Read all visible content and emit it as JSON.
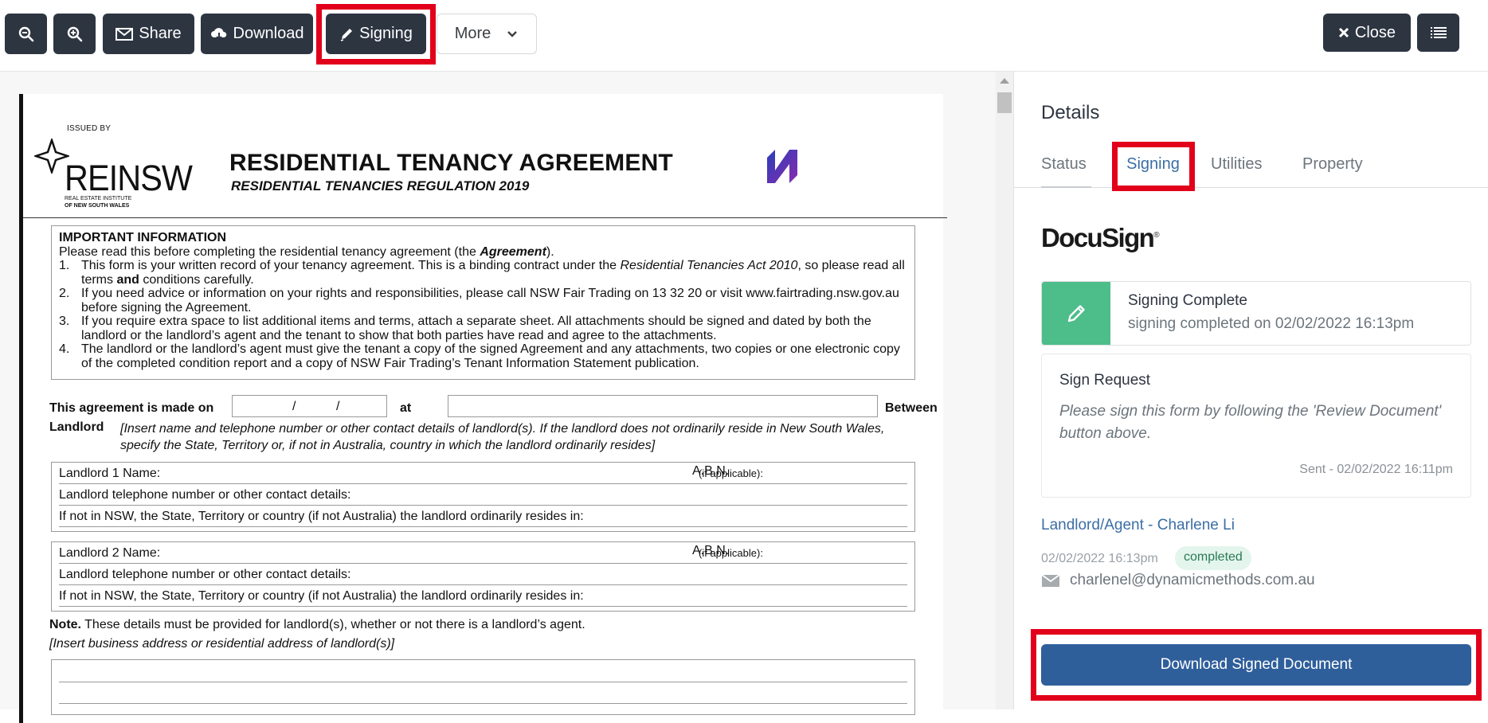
{
  "toolbar": {
    "zoom_out_icon": "zoom-out-icon",
    "zoom_in_icon": "zoom-in-icon",
    "share_label": "Share",
    "download_label": "Download",
    "signing_label": "Signing",
    "more_label": "More",
    "close_label": "Close"
  },
  "document": {
    "issued_by": "ISSUED BY",
    "logo_text": "REINSW",
    "logo_sub1": "REAL ESTATE INSTITUTE",
    "logo_sub2": "OF NEW SOUTH WALES",
    "title": "RESIDENTIAL TENANCY AGREEMENT",
    "subtitle": "RESIDENTIAL TENANCIES REGULATION 2019",
    "important_heading": "IMPORTANT INFORMATION",
    "important_intro_a": "Please read this before completing the residential tenancy agreement (the ",
    "important_intro_b": "Agreement",
    "important_intro_c": ").",
    "items": [
      {
        "n": "1.",
        "a": "This form is your written record of your tenancy agreement. This is a binding contract under the ",
        "i": "Residential Tenancies Act 2010",
        "b": ", so please read all terms ",
        "bold": "and",
        "c": " conditions carefully."
      },
      {
        "n": "2.",
        "a": "If you need advice or information on your rights and responsibilities, please call NSW Fair Trading on 13 32 20 or visit www.fairtrading.nsw.gov.au before signing the Agreement."
      },
      {
        "n": "3.",
        "a": "If you require extra space to list additional items and terms, attach a separate sheet. All attachments should be signed and dated by both the landlord or the landlord’s agent and the tenant to show that both parties have read and agree to the attachments."
      },
      {
        "n": "4.",
        "a": "The landlord or the landlord’s agent must give the tenant a copy of the signed Agreement and any attachments, two copies or one electronic copy of the completed condition report and a copy of NSW Fair Trading’s Tenant Information Statement publication."
      }
    ],
    "made_label": "This agreement is made on",
    "date_sep": "/",
    "at_label": "at",
    "between_label": "Between",
    "landlord_label": "Landlord",
    "landlord_instr": "[Insert name and telephone number or other contact details of landlord(s). If the landlord does not ordinarily reside in New South Wales, specify the State, Territory or, if not in Australia, country in which the landlord ordinarily resides]",
    "landlord1_name": "Landlord 1   Name:",
    "landlord2_name": "Landlord 2   Name:",
    "abn": "A.B.N.",
    "abn_note": "(if applicable):",
    "phone_row": "Landlord telephone number or other contact details:",
    "resides_row": "If not in NSW, the State, Territory or country (if not Australia) the landlord ordinarily resides in:",
    "note_bold": "Note.",
    "note_text": " These details must be provided for landlord(s), whether or not there is a landlord’s agent.",
    "note2": "[Insert business address or residential address of landlord(s)]"
  },
  "panel": {
    "title": "Details",
    "tabs": [
      "Status",
      "Signing",
      "Utilities",
      "Property"
    ],
    "brand": "DocuSign",
    "complete_title": "Signing Complete",
    "complete_sub": "signing completed on 02/02/2022 16:13pm",
    "request_title": "Sign Request",
    "request_msg": "Please sign this form by following the 'Review Document' button above.",
    "request_sent": "Sent - 02/02/2022 16:11pm",
    "signer_name": "Landlord/Agent - Charlene Li",
    "signer_date": "02/02/2022 16:13pm",
    "signer_status": "completed",
    "signer_email": "charlenel@dynamicmethods.com.au",
    "download_signed": "Download Signed Document"
  },
  "colors": {
    "toolbar_button": "#2d3541",
    "highlight": "#e2001a",
    "accent": "#3b6ea5",
    "success": "#4dbd8a",
    "primary_button": "#2f5f9b"
  }
}
